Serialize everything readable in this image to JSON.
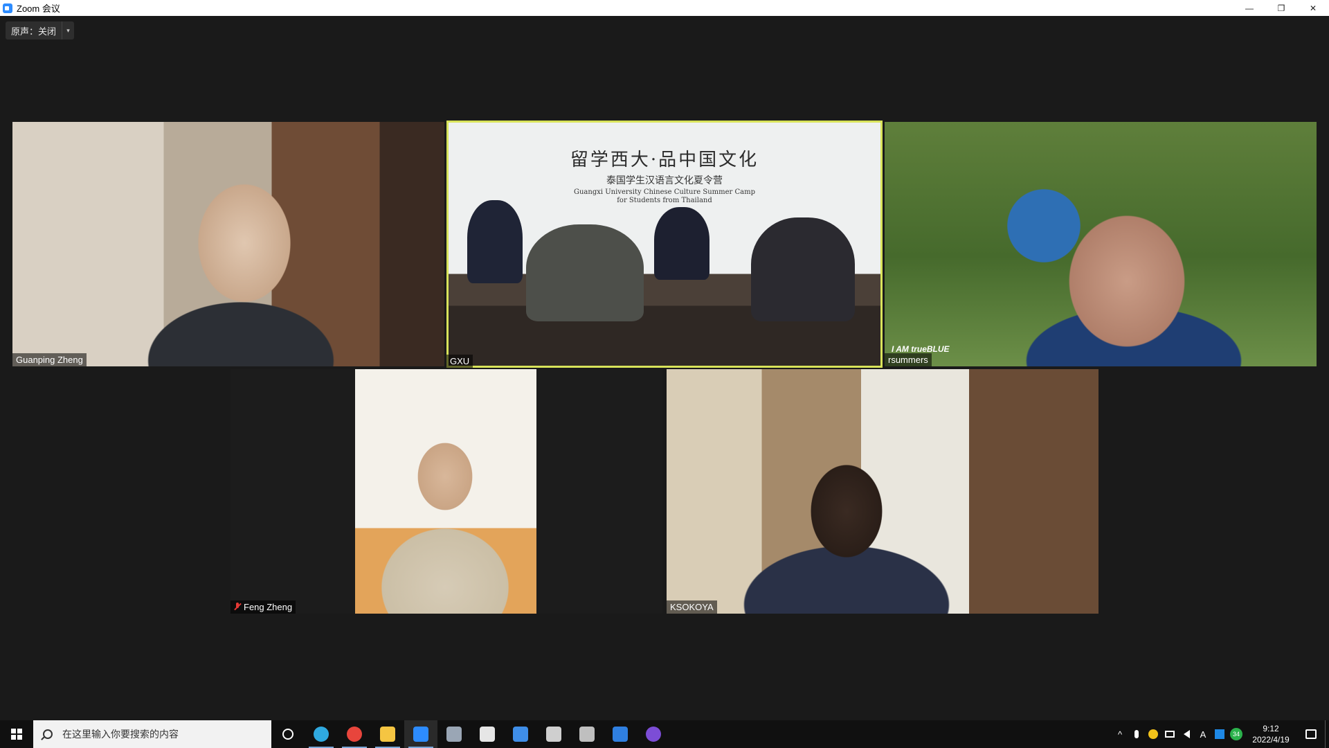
{
  "window": {
    "title": "Zoom 会议",
    "minimize": "—",
    "restore": "❐",
    "close": "✕"
  },
  "audio": {
    "label": "原声：关闭",
    "caret": "▾"
  },
  "participants": [
    {
      "name": "Guanping Zheng",
      "muted": false,
      "speaking": false
    },
    {
      "name": "GXU",
      "muted": false,
      "speaking": true
    },
    {
      "name": "rsummers",
      "muted": false,
      "speaking": false
    },
    {
      "name": "Feng Zheng",
      "muted": true,
      "speaking": false
    },
    {
      "name": "KSOKOYA",
      "muted": false,
      "speaking": false
    }
  ],
  "gxu_banner": {
    "title": "留学西大·品中国文化",
    "subtitle": "泰国学生汉语言文化夏令营",
    "english_line1": "Guangxi University Chinese Culture Summer Camp",
    "english_line2": "for Students from Thailand"
  },
  "rsummers_banner": "I AM trueBLUE",
  "taskbar": {
    "search_placeholder": "在这里输入你要搜索的内容",
    "apps": [
      {
        "name": "edge-icon",
        "color": "#2fa9e0"
      },
      {
        "name": "chrome-icon",
        "color": "#e8453c"
      },
      {
        "name": "file-explorer-icon",
        "color": "#f5c542"
      },
      {
        "name": "zoom-icon",
        "color": "#2d8cff"
      },
      {
        "name": "pinned-app-5-icon",
        "color": "#9aa6b5"
      },
      {
        "name": "pinned-app-6-icon",
        "color": "#e6e6e6"
      },
      {
        "name": "pinned-app-7-icon",
        "color": "#3f8ee8"
      },
      {
        "name": "pinned-app-8-icon",
        "color": "#cfcfcf"
      },
      {
        "name": "pinned-app-9-icon",
        "color": "#bfbfbf"
      },
      {
        "name": "pinned-app-10-icon",
        "color": "#2f7fe0"
      },
      {
        "name": "pinned-app-11-icon",
        "color": "#7c4dd6"
      }
    ],
    "tray": {
      "chevron": "^",
      "ime": "A",
      "badge": "34",
      "time": "9:12",
      "date": "2022/4/19"
    }
  }
}
